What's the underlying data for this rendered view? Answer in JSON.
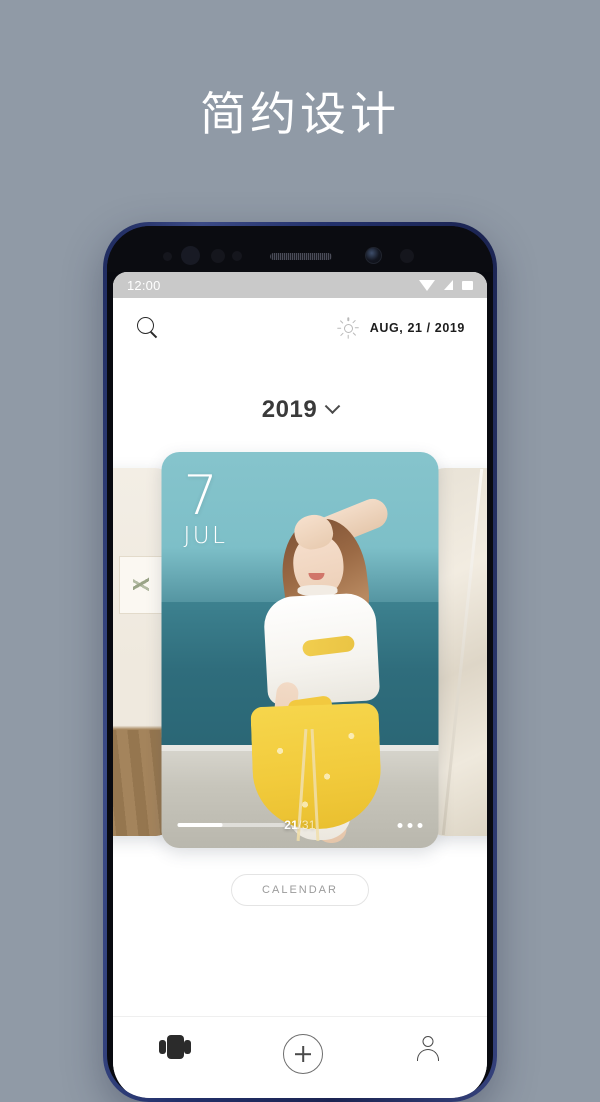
{
  "promo": {
    "headline": "简约设计"
  },
  "device": {
    "frame_color": "#24306b",
    "sensors": [
      "proximity-sensor",
      "iris-scanner",
      "light-sensor",
      "led-indicator",
      "earpiece-speaker",
      "front-camera",
      "sensor-dot"
    ]
  },
  "status_bar": {
    "time": "12:00",
    "icons": [
      "wifi-icon",
      "signal-icon",
      "battery-icon"
    ],
    "background": "#c9c9c9"
  },
  "app_header": {
    "search_icon": "search-icon",
    "weather_icon": "sun-icon",
    "date": "AUG, 21 / 2019"
  },
  "year_selector": {
    "year": "2019",
    "chevron": "chevron-down-icon"
  },
  "carousel": {
    "main_card": {
      "day": "7",
      "month": "JUL",
      "counter_current": "21",
      "counter_total": "/31",
      "progress_percent": 42,
      "more_icon": "more-dots-icon",
      "photo_description": "woman in white top and yellow patterned skirt by the sea"
    },
    "left_card": {
      "photo_description": "cream interior wall with framed plant print and wooden floor"
    },
    "right_card": {
      "photo_description": "light beige draped fabric"
    }
  },
  "calendar_button": {
    "label": "CALENDAR"
  },
  "bottom_nav": {
    "items": [
      {
        "label": "Cards",
        "icon": "carousel-icon"
      },
      {
        "label": "Add",
        "icon": "plus-icon"
      },
      {
        "label": "Profile",
        "icon": "person-icon"
      }
    ]
  },
  "colors": {
    "background": "#909aa6",
    "accent_teal": "#4f8f9c",
    "accent_yellow": "#f2cb3c",
    "text_dark": "#1d1d1d",
    "text_muted": "#9b9b9b"
  }
}
